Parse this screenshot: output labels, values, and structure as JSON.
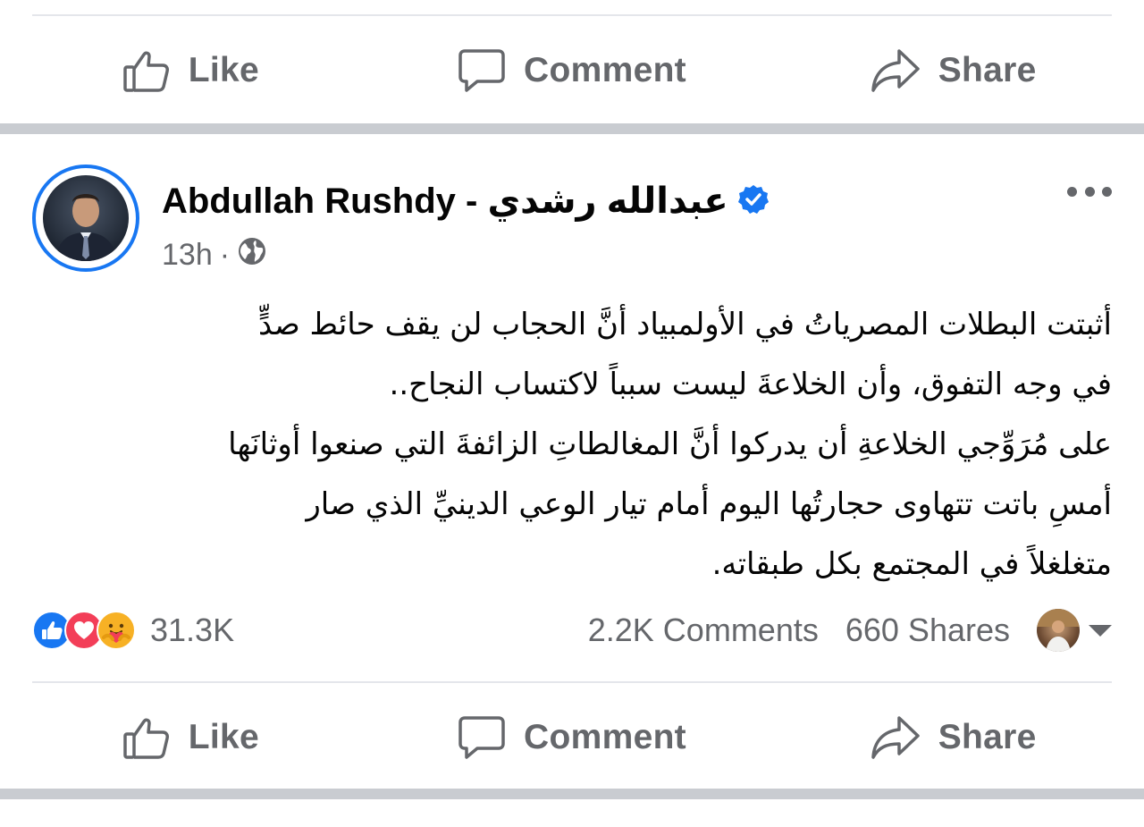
{
  "top_actions": {
    "like_label": "Like",
    "comment_label": "Comment",
    "share_label": "Share"
  },
  "post": {
    "author": {
      "name": "Abdullah Rushdy - عبدالله رشدي",
      "verified": true,
      "verified_icon": "verified-badge-icon"
    },
    "time": "13h",
    "separator_dot": "·",
    "audience_icon": "globe-icon",
    "body_lines": [
      "أثبتت البطلات المصرياتُ في الأولمبياد أنَّ الحجاب لن يقف حائط صدٍّ",
      "في وجه التفوق، وأن الخلاعةَ ليست سبباً لاكتساب النجاح..",
      "على مُرَوِّجي الخلاعةِ أن يدركوا أنَّ المغالطاتِ الزائفةَ التي صنعوا أوثانَها",
      "أمسِ باتت تتهاوى حجارتُها اليوم أمام تيار الوعي الدينيِّ الذي صار",
      "متغلغلاً في المجتمع بكل طبقاته."
    ],
    "reactions": {
      "icons": [
        "like-reaction-icon",
        "love-reaction-icon",
        "care-reaction-icon"
      ],
      "count": "31.3K"
    },
    "comments_count": "2.2K Comments",
    "shares_count": "660 Shares"
  },
  "bottom_actions": {
    "like_label": "Like",
    "comment_label": "Comment",
    "share_label": "Share"
  },
  "colors": {
    "accent": "#1877f2",
    "muted_text": "#65676b",
    "separator": "#c9ccd1",
    "love": "#f33e58",
    "care": "#f7b125"
  }
}
